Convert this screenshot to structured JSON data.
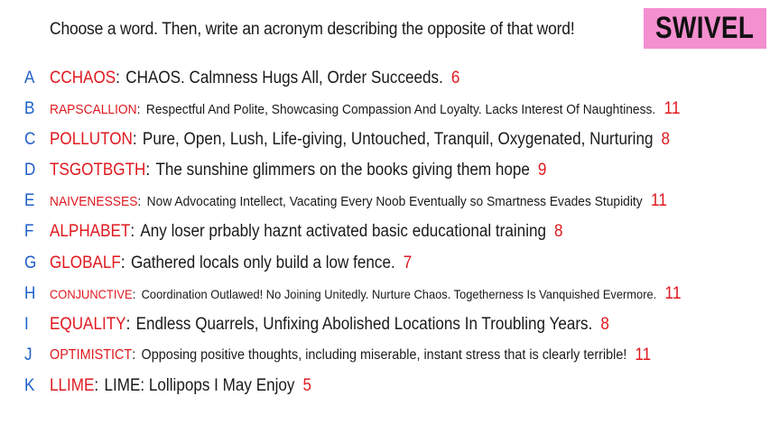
{
  "prompt": "Choose a word. Then, write an acronym describing the opposite of that word!",
  "badge": "SWIVEL",
  "colors": {
    "letter": "#1f5fc9",
    "word": "#e0191f",
    "score": "#e0191f",
    "badge_bg": "#f48fd0"
  },
  "rows": [
    {
      "letter": "A",
      "word": "CCHAOS",
      "acronym": "CHAOS. Calmness Hugs All, Order Succeeds.",
      "score": "6"
    },
    {
      "letter": "B",
      "word": "RAPSCALLION",
      "acronym": "Respectful And Polite, Showcasing Compassion And Loyalty. Lacks Interest Of Naughtiness.",
      "score": "11"
    },
    {
      "letter": "C",
      "word": "POLLUTON",
      "acronym": "Pure, Open, Lush, Life-giving, Untouched, Tranquil, Oxygenated, Nurturing",
      "score": "8"
    },
    {
      "letter": "D",
      "word": "TSGOTBGTH",
      "acronym": "The sunshine glimmers on the books giving them hope",
      "score": "9"
    },
    {
      "letter": "E",
      "word": "NAIVENESSES",
      "acronym": "Now Advocating Intellect, Vacating Every Noob Eventually so Smartness Evades Stupidity",
      "score": "11"
    },
    {
      "letter": "F",
      "word": "ALPHABET",
      "acronym": "Any loser prbably haznt activated basic educational training",
      "score": "8"
    },
    {
      "letter": "G",
      "word": "GLOBALF",
      "acronym": "Gathered locals only build a low fence.",
      "score": "7"
    },
    {
      "letter": "H",
      "word": "CONJUNCTIVE",
      "acronym": "Coordination Outlawed! No Joining Unitedly. Nurture Chaos. Togetherness Is Vanquished Evermore.",
      "score": "11"
    },
    {
      "letter": "I",
      "word": "EQUALITY",
      "acronym": "Endless Quarrels, Unfixing Abolished Locations In Troubling Years.",
      "score": "8"
    },
    {
      "letter": "J",
      "word": "OPTIMISTICT",
      "acronym": "Opposing positive thoughts, including miserable, instant stress that is clearly terrible!",
      "score": "11"
    },
    {
      "letter": "K",
      "word": "LLIME",
      "acronym": "LIME: Lollipops I May Enjoy",
      "score": "5"
    }
  ]
}
